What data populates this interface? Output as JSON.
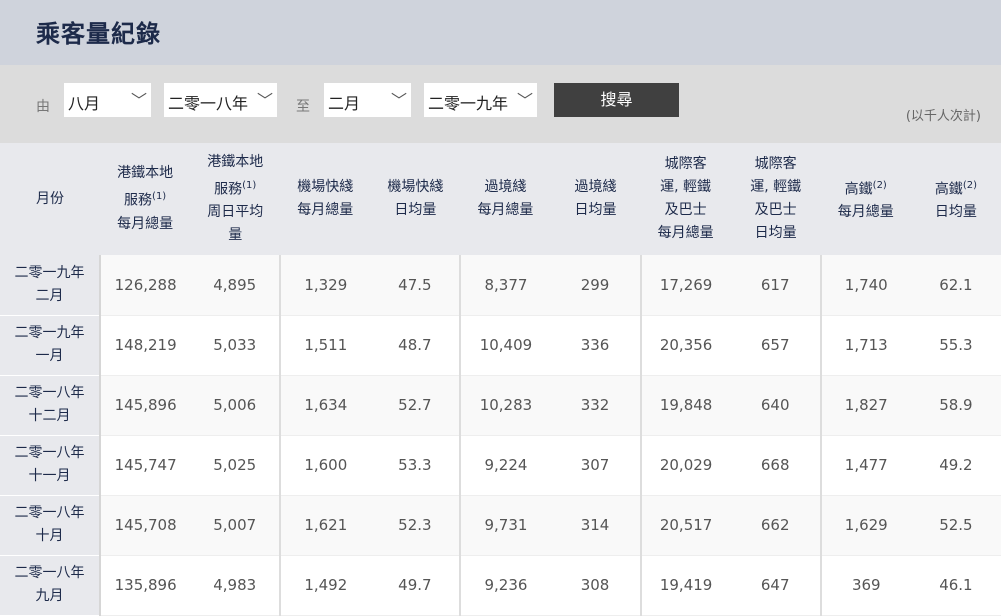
{
  "title": "乘客量紀錄",
  "filter": {
    "from_label": "由",
    "from_month": "八月",
    "from_year": "二零一八年",
    "to_label": "至",
    "to_month": "二月",
    "to_year": "二零一九年",
    "search": "搜尋",
    "note": "(以千人次計)"
  },
  "headers": [
    {
      "l1": "月份"
    },
    {
      "l1": "港鐵本地",
      "l2": "服務",
      "sup": "(1)",
      "l3": "每月總量"
    },
    {
      "l1": "港鐵本地",
      "l2": "服務",
      "sup": "(1)",
      "l3": "周日平均",
      "l4": "量"
    },
    {
      "l1": "機場快綫",
      "l3": "每月總量"
    },
    {
      "l1": "機場快綫",
      "l3": "日均量"
    },
    {
      "l1": "過境綫",
      "l3": "每月總量"
    },
    {
      "l1": "過境綫",
      "l3": "日均量"
    },
    {
      "l1": "城際客",
      "l2": "運, 輕鐵",
      "l3": "及巴士",
      "l4": "每月總量"
    },
    {
      "l1": "城際客",
      "l2": "運, 輕鐵",
      "l3": "及巴士",
      "l4": "日均量"
    },
    {
      "l2": "高鐵",
      "sup": "(2)",
      "l3": "每月總量"
    },
    {
      "l2": "高鐵",
      "sup": "(2)",
      "l3": "日均量"
    }
  ],
  "rows": [
    {
      "year": "二零一九年",
      "month": "二月",
      "v": [
        "126,288",
        "4,895",
        "1,329",
        "47.5",
        "8,377",
        "299",
        "17,269",
        "617",
        "1,740",
        "62.1"
      ]
    },
    {
      "year": "二零一九年",
      "month": "一月",
      "v": [
        "148,219",
        "5,033",
        "1,511",
        "48.7",
        "10,409",
        "336",
        "20,356",
        "657",
        "1,713",
        "55.3"
      ]
    },
    {
      "year": "二零一八年",
      "month": "十二月",
      "v": [
        "145,896",
        "5,006",
        "1,634",
        "52.7",
        "10,283",
        "332",
        "19,848",
        "640",
        "1,827",
        "58.9"
      ]
    },
    {
      "year": "二零一八年",
      "month": "十一月",
      "v": [
        "145,747",
        "5,025",
        "1,600",
        "53.3",
        "9,224",
        "307",
        "20,029",
        "668",
        "1,477",
        "49.2"
      ]
    },
    {
      "year": "二零一八年",
      "month": "十月",
      "v": [
        "145,708",
        "5,007",
        "1,621",
        "52.3",
        "9,731",
        "314",
        "20,517",
        "662",
        "1,629",
        "52.5"
      ]
    },
    {
      "year": "二零一八年",
      "month": "九月",
      "v": [
        "135,896",
        "4,983",
        "1,492",
        "49.7",
        "9,236",
        "308",
        "19,419",
        "647",
        "369",
        "46.1"
      ]
    }
  ]
}
